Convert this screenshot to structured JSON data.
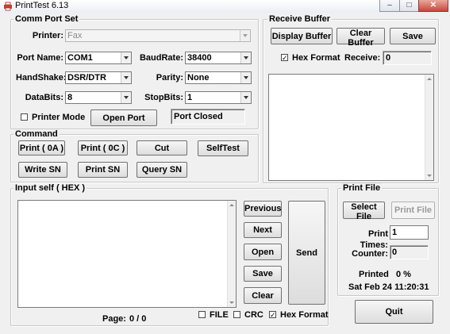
{
  "window": {
    "title": "PrintTest   6.13",
    "minimize_glyph": "–",
    "maximize_glyph": "□",
    "close_glyph": "✕"
  },
  "comm_port": {
    "title": "Comm Port Set",
    "printer_label": "Printer:",
    "printer_value": "Fax",
    "port_label": "Port Name:",
    "port_value": "COM1",
    "baud_label": "BaudRate:",
    "baud_value": "38400",
    "handshake_label": "HandShake:",
    "handshake_value": "DSR/DTR",
    "parity_label": "Parity:",
    "parity_value": "None",
    "databits_label": "DataBits:",
    "databits_value": "8",
    "stopbits_label": "StopBits:",
    "stopbits_value": "1",
    "printer_mode_label": "Printer Mode",
    "printer_mode_checked": "",
    "open_port_label": "Open Port",
    "port_status": "Port Closed"
  },
  "command": {
    "title": "Command",
    "print_0a": "Print ( 0A )",
    "print_0c": "Print ( 0C )",
    "cut": "Cut",
    "selftest": "SelfTest",
    "write_sn": "Write SN",
    "print_sn": "Print SN",
    "query_sn": "Query SN"
  },
  "receive": {
    "title": "Receive Buffer",
    "display_buffer": "Display Buffer",
    "clear_buffer": "Clear Buffer",
    "save": "Save",
    "hex_format_label": "Hex Format",
    "hex_format_checked": "✓",
    "receive_label": "Receive:",
    "receive_value": "0",
    "buffer_text": ""
  },
  "input_self": {
    "title": "Input self ( HEX )",
    "text": "",
    "previous": "Previous",
    "next": "Next",
    "open": "Open",
    "save": "Save",
    "clear": "Clear",
    "send": "Send",
    "page_label": "Page:",
    "page_value": "0 / 0",
    "file_label": "FILE",
    "file_checked": "",
    "crc_label": "CRC",
    "crc_checked": "",
    "hex_format_label": "Hex Format",
    "hex_format_checked": "✓"
  },
  "print_file": {
    "title": "Print File",
    "select_file": "Select File",
    "print_file_button": "Print File",
    "print_times_label": "Print Times:",
    "print_times_value": "1",
    "counter_label": "Counter:",
    "counter_value": "0",
    "printed_label": "Printed",
    "printed_percent": "0 %",
    "datetime": "Sat Feb 24 11:20:31"
  },
  "quit_label": "Quit",
  "icons": {
    "app": "printer-app-icon",
    "scroll_up": "scroll-up-icon",
    "scroll_down": "scroll-down-icon",
    "dropdown": "chevron-down-icon"
  },
  "colors": {
    "window_bg": "#f0f0f0",
    "close_button": "#c7473b",
    "app_icon": "#d43b2a"
  }
}
